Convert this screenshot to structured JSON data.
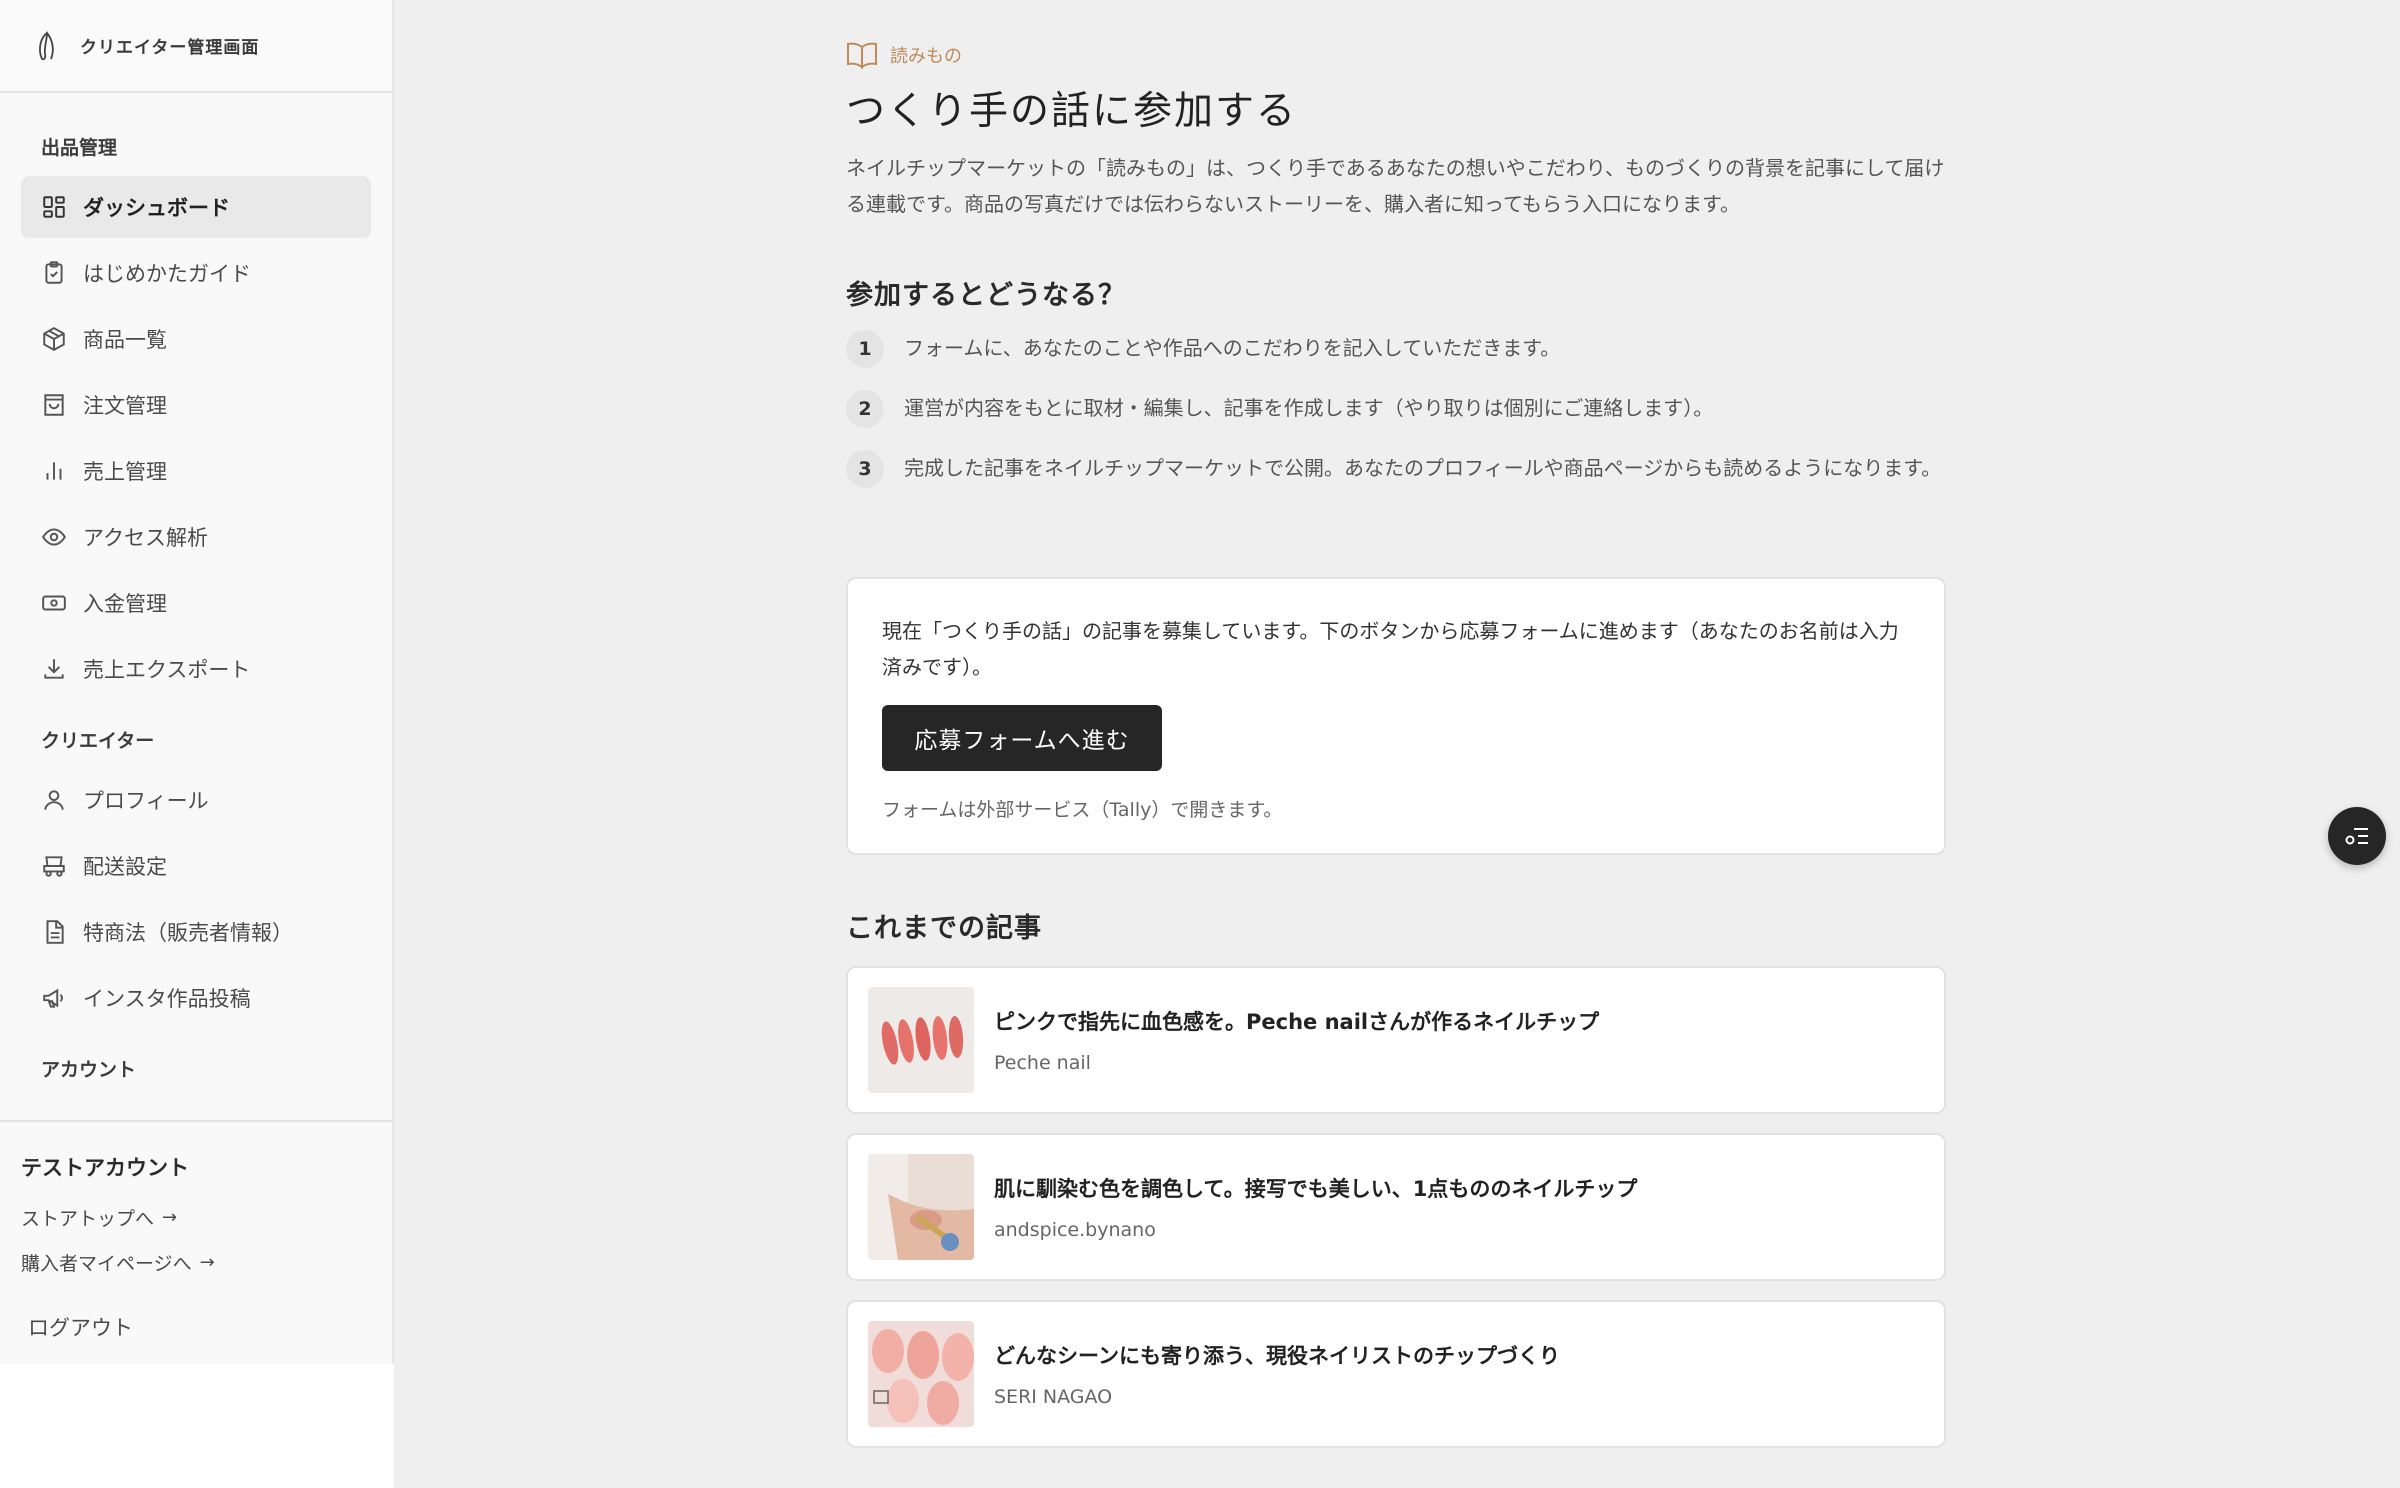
{
  "sidebar": {
    "app_title": "クリエイター管理画面",
    "sections": {
      "listing": "出品管理",
      "creator": "クリエイター",
      "account": "アカウント"
    },
    "listing_items": [
      {
        "label": "ダッシュボード",
        "icon": "dashboard-icon",
        "active": true
      },
      {
        "label": "はじめかたガイド",
        "icon": "clipboard-icon"
      },
      {
        "label": "商品一覧",
        "icon": "box-icon"
      },
      {
        "label": "注文管理",
        "icon": "shopping-bag-icon"
      },
      {
        "label": "売上管理",
        "icon": "bar-chart-icon"
      },
      {
        "label": "アクセス解析",
        "icon": "eye-icon"
      },
      {
        "label": "入金管理",
        "icon": "banknote-icon"
      },
      {
        "label": "売上エクスポート",
        "icon": "download-icon"
      }
    ],
    "creator_items": [
      {
        "label": "プロフィール",
        "icon": "user-icon"
      },
      {
        "label": "配送設定",
        "icon": "truck-icon"
      },
      {
        "label": "特商法（販売者情報）",
        "icon": "document-icon"
      },
      {
        "label": "インスタ作品投稿",
        "icon": "megaphone-icon"
      }
    ],
    "footer": {
      "account_name": "テストアカウント",
      "store_top": "ストアトップへ",
      "buyer_page": "購入者マイページへ",
      "logout": "ログアウト"
    }
  },
  "main": {
    "eyebrow": "読みもの",
    "title": "つくり手の話に参加する",
    "intro": "ネイルチップマーケットの「読みもの」は、つくり手であるあなたの想いやこだわり、ものづくりの背景を記事にして届ける連載です。商品の写真だけでは伝わらないストーリーを、購入者に知ってもらう入口になります。",
    "how_title": "参加するとどうなる？",
    "steps": [
      {
        "num": "1",
        "text": "フォームに、あなたのことや作品へのこだわりを記入していただきます。"
      },
      {
        "num": "2",
        "text": "運営が内容をもとに取材・編集し、記事を作成します（やり取りは個別にご連絡します）。"
      },
      {
        "num": "3",
        "text": "完成した記事をネイルチップマーケットで公開。あなたのプロフィールや商品ページからも読めるようになります。"
      }
    ],
    "card": {
      "text": "現在「つくり手の話」の記事を募集しています。下のボタンから応募フォームに進めます（あなたのお名前は入力済みです）。",
      "button": "応募フォームへ進む",
      "note": "フォームは外部サービス（Tally）で開きます。"
    },
    "articles_title": "これまでの記事",
    "articles": [
      {
        "title": "ピンクで指先に血色感を。Peche nailさんが作るネイルチップ",
        "author": "Peche nail"
      },
      {
        "title": "肌に馴染む色を調色して。接写でも美しい、1点もののネイルチップ",
        "author": "andspice.bynano"
      },
      {
        "title": "どんなシーンにも寄り添う、現役ネイリストのチップづくり",
        "author": "SERI NAGAO"
      }
    ]
  },
  "colors": {
    "accent": "#c08a5a",
    "button_bg": "#262626",
    "page_bg": "#efefef"
  }
}
